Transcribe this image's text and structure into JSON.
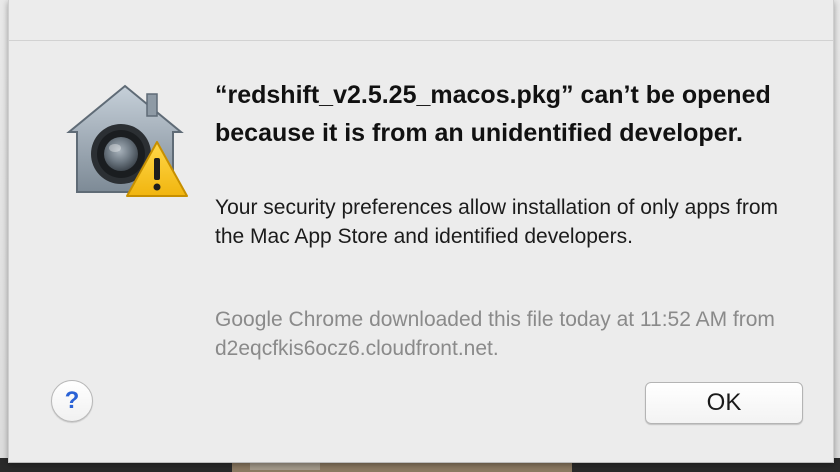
{
  "dialog": {
    "icon": "gatekeeper-security-icon",
    "headline": "“redshift_v2.5.25_macos.pkg” can’t be opened because it is from an unidentified developer.",
    "message": "Your security preferences allow installation of only apps from the Mac App Store and identified developers.",
    "source_note": "Google Chrome downloaded this file today at 11:52 AM from d2eqcfkis6ocz6.cloudfront.net.",
    "help_button_label": "?",
    "ok_button_label": "OK"
  },
  "colors": {
    "dialog_background": "#ececec",
    "warning_yellow": "#f4c21e",
    "help_blue": "#2a62d6"
  }
}
